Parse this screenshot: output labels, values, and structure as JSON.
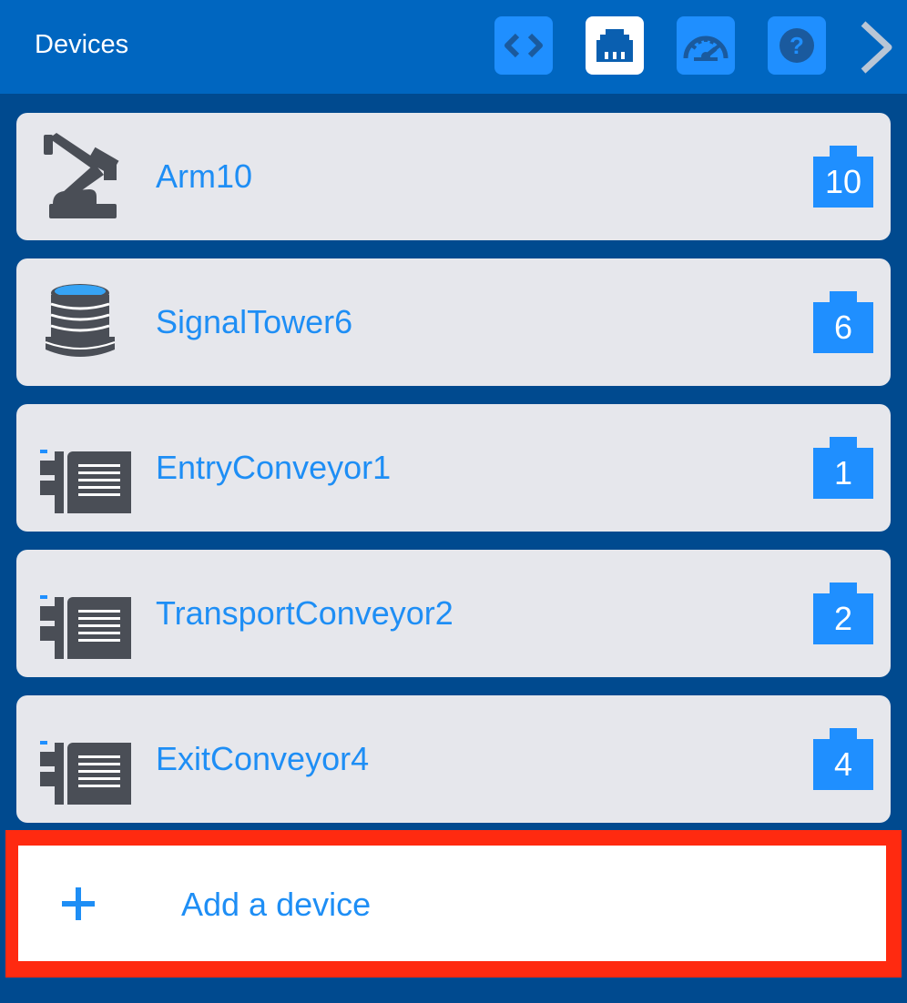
{
  "header": {
    "title": "Devices",
    "toolbar": [
      {
        "name": "code-view-button",
        "icon": "code-icon",
        "active": false
      },
      {
        "name": "devices-view-button",
        "icon": "network-port-icon",
        "active": true
      },
      {
        "name": "dashboard-view-button",
        "icon": "speedometer-icon",
        "active": false
      },
      {
        "name": "help-button",
        "icon": "help-icon",
        "active": false
      }
    ],
    "next_icon": "chevron-right-icon"
  },
  "devices": [
    {
      "name": "Arm10",
      "icon": "robot-arm-icon",
      "port": "10"
    },
    {
      "name": "SignalTower6",
      "icon": "signal-tower-icon",
      "port": "6"
    },
    {
      "name": "EntryConveyor1",
      "icon": "conveyor-icon",
      "port": "1"
    },
    {
      "name": "TransportConveyor2",
      "icon": "conveyor-icon",
      "port": "2"
    },
    {
      "name": "ExitConveyor4",
      "icon": "conveyor-icon",
      "port": "4"
    }
  ],
  "add_device": {
    "label": "Add a device",
    "icon": "plus-icon"
  },
  "colors": {
    "header": "#0066c0",
    "background": "#004a8f",
    "accent": "#1e8ef5",
    "card": "#e6e7ec",
    "highlight": "#ff2a10"
  }
}
